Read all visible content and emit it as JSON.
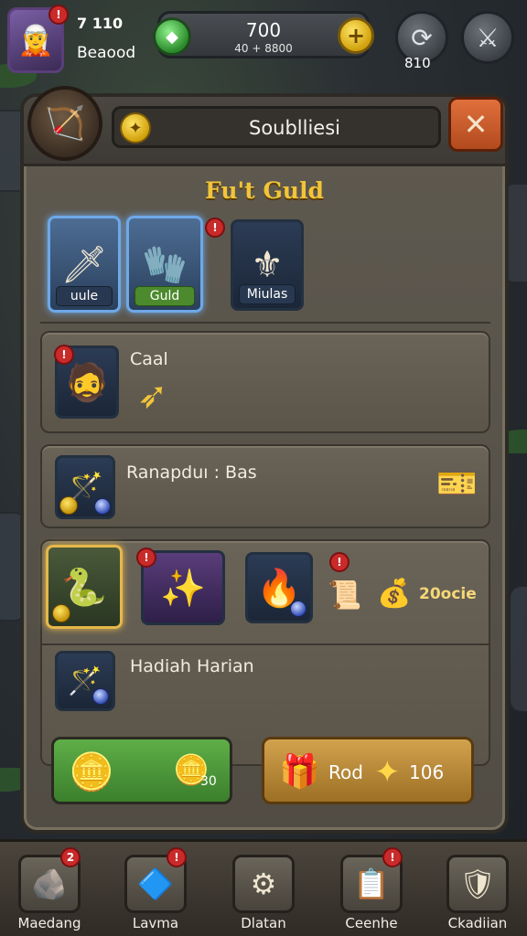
{
  "hud": {
    "player_level": "7 110",
    "player_name": "Beaood",
    "avatar_badge": "!",
    "resource_main": "700",
    "resource_sub": "40 + 8800",
    "settings_count": "810"
  },
  "panel": {
    "title": "Soublliesi",
    "section_title": "Fu't Guld",
    "top_slots": [
      {
        "label": "uule"
      },
      {
        "label": "Guld"
      },
      {
        "label": "Miulas"
      }
    ],
    "row1_text": "Caal",
    "row2_text": "Ranapduı : Bas",
    "reward_count": "20ocie",
    "row4_text": "Hadiah Harian",
    "green_button_count": "30",
    "gold_button_label": "Rod",
    "gold_button_value": "106"
  },
  "nav": {
    "items": [
      {
        "label": "Maedang",
        "badge": "2"
      },
      {
        "label": "Lavma",
        "badge": "!"
      },
      {
        "label": "Dlatan",
        "badge": ""
      },
      {
        "label": "Ceenhe",
        "badge": "!"
      },
      {
        "label": "Ckadiian",
        "badge": ""
      }
    ]
  },
  "colors": {
    "accent_gold": "#f1c43a",
    "close_orange": "#e0703c",
    "badge_red": "#c92a2a",
    "button_green": "#5fae48"
  },
  "icons": [
    "hero-avatar-icon",
    "green-gem-icon",
    "plus-icon",
    "swap-icon",
    "sword-icon",
    "bow-emblem-icon",
    "coin-icon",
    "close-icon",
    "weapon-icon",
    "scroll-icon",
    "ticket-icon",
    "chest-icon",
    "star-icon",
    "gear-icon"
  ]
}
